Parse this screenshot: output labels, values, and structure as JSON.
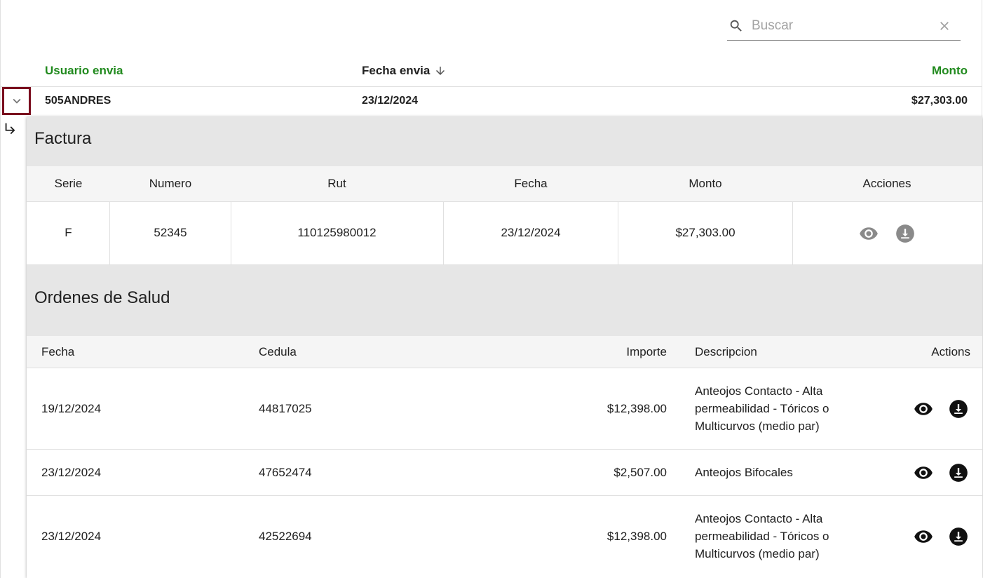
{
  "search": {
    "placeholder": "Buscar",
    "value": ""
  },
  "main_table": {
    "headers": {
      "user": "Usuario envia",
      "date": "Fecha envia",
      "amount": "Monto"
    },
    "row": {
      "user": "505ANDRES",
      "date": "23/12/2024",
      "amount": "$27,303.00"
    }
  },
  "factura": {
    "title": "Factura",
    "headers": {
      "serie": "Serie",
      "numero": "Numero",
      "rut": "Rut",
      "fecha": "Fecha",
      "monto": "Monto",
      "acciones": "Acciones"
    },
    "row": {
      "serie": "F",
      "numero": "52345",
      "rut": "110125980012",
      "fecha": "23/12/2024",
      "monto": "$27,303.00"
    }
  },
  "ordenes": {
    "title": "Ordenes de Salud",
    "headers": {
      "fecha": "Fecha",
      "cedula": "Cedula",
      "importe": "Importe",
      "descripcion": "Descripcion",
      "actions": "Actions"
    },
    "rows": [
      {
        "fecha": "19/12/2024",
        "cedula": "44817025",
        "importe": "$12,398.00",
        "descripcion": "Anteojos Contacto - Alta permeabilidad - Tóricos o Multicurvos (medio par)"
      },
      {
        "fecha": "23/12/2024",
        "cedula": "47652474",
        "importe": "$2,507.00",
        "descripcion": "Anteojos Bifocales"
      },
      {
        "fecha": "23/12/2024",
        "cedula": "42522694",
        "importe": "$12,398.00",
        "descripcion": "Anteojos Contacto - Alta permeabilidad - Tóricos o Multicurvos (medio par)"
      }
    ]
  },
  "colors": {
    "header_green": "#218a1e",
    "toggle_border": "#7a0d1e",
    "section_bg": "#e6e6e6",
    "subheader_bg": "#f5f5f5"
  },
  "icons": [
    "search-icon",
    "close-icon",
    "arrow-down-icon",
    "chevron-down-icon",
    "subdirectory-arrow-icon",
    "eye-icon",
    "download-icon"
  ]
}
